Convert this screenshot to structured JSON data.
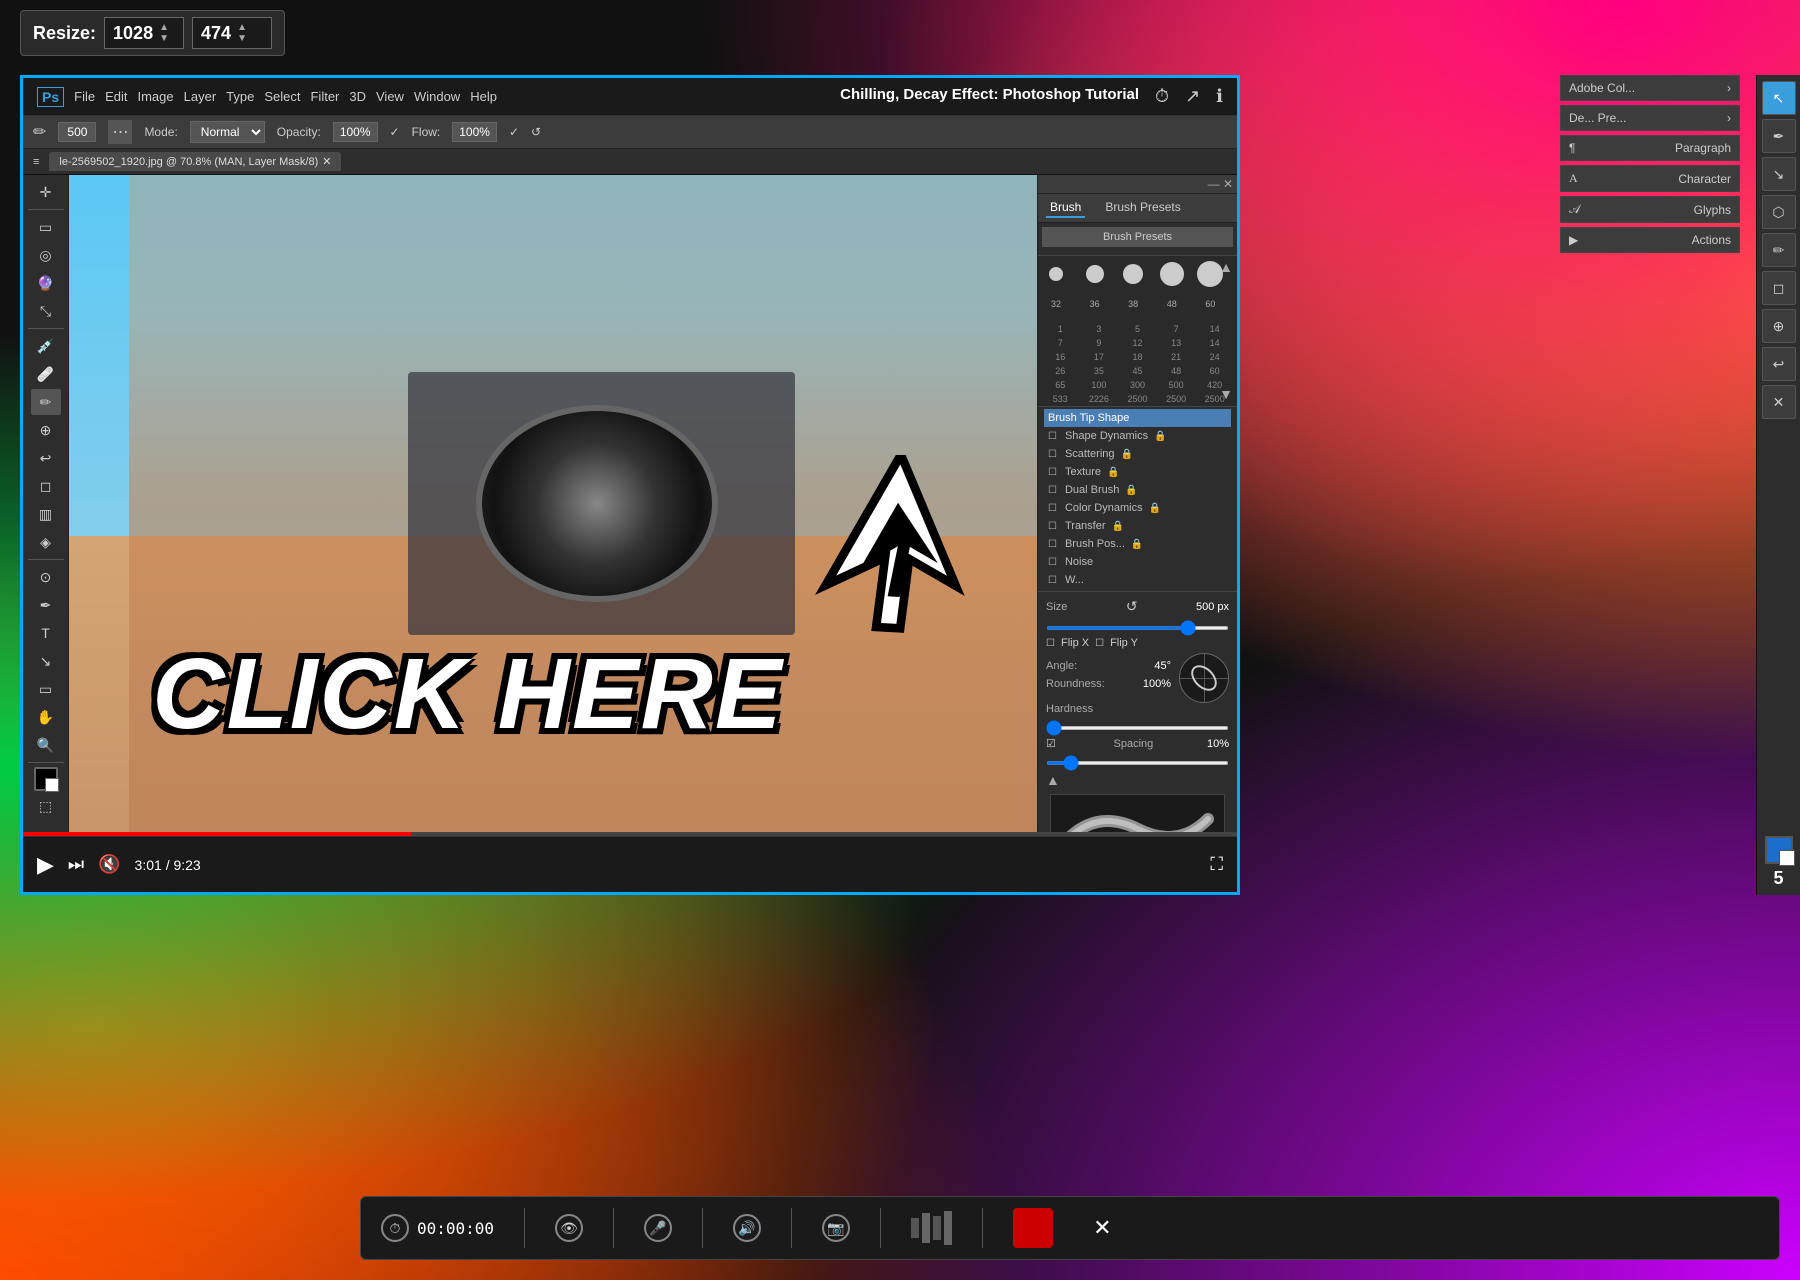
{
  "background": {
    "desc": "colorful swirl background"
  },
  "resize_bar": {
    "label": "Resize:",
    "width": "1028",
    "height": "474"
  },
  "video": {
    "title": "Chilling, Decay Effect: Photoshop Tutorial",
    "current_time": "3:01",
    "total_time": "9:23",
    "progress_pct": 32
  },
  "ps": {
    "logo": "Ps",
    "menu_items": [
      "File",
      "Edit",
      "Image",
      "Layer",
      "Type",
      "Select",
      "Filter",
      "3D",
      "View",
      "Window",
      "Help"
    ],
    "tab_name": "le-2569502_1920.jpg @ 70.8% (MAN, Layer Mask/8)",
    "mode_label": "Mode:",
    "mode_value": "Normal",
    "opacity_label": "Opacity:",
    "opacity_value": "100%",
    "flow_label": "Flow:",
    "flow_value": "100%",
    "brush_size": "500"
  },
  "brush_panel": {
    "tab1": "Brush",
    "tab2": "Brush Presets",
    "presets_btn": "Brush Presets",
    "categories": [
      {
        "name": "Brush Tip Shape",
        "active": true,
        "locked": false
      },
      {
        "name": "Shape Dynamics",
        "active": false,
        "locked": true
      },
      {
        "name": "Scattering",
        "active": false,
        "locked": true
      },
      {
        "name": "Texture",
        "active": false,
        "locked": true
      },
      {
        "name": "Dual Brush",
        "active": false,
        "locked": true
      },
      {
        "name": "Color Dynamics",
        "active": false,
        "locked": true
      },
      {
        "name": "Transfer",
        "active": false,
        "locked": true
      },
      {
        "name": "Brush Pos...",
        "active": false,
        "locked": true
      },
      {
        "name": "Noise",
        "active": false,
        "locked": true
      },
      {
        "name": "W...",
        "active": false,
        "locked": true
      }
    ],
    "brush_sizes": [
      [
        32,
        36,
        38,
        48,
        60
      ],
      [
        1,
        3,
        5,
        7,
        14
      ],
      [
        7,
        9,
        12,
        13,
        14
      ],
      [
        16,
        17,
        18,
        21,
        24
      ],
      [
        26,
        35,
        45,
        48,
        60
      ],
      [
        65,
        100,
        300,
        500,
        420
      ],
      [
        533,
        2226,
        2500,
        2500,
        2500
      ]
    ],
    "size_label": "Size",
    "size_value": "500 px",
    "flip_x": "Flip X",
    "flip_y": "Flip Y",
    "angle_label": "Angle:",
    "angle_value": "45°",
    "roundness_label": "Roundness:",
    "roundness_value": "100%",
    "hardness_label": "Hardness",
    "spacing_label": "Spacing",
    "spacing_value": "10%"
  },
  "tools": {
    "items": [
      "↖",
      "◻",
      "◎",
      "✏",
      "✂",
      "◈",
      "✒",
      "⟳",
      "🖊",
      "T",
      "↙",
      "☁",
      "🔍",
      "⬛",
      "⬜"
    ]
  },
  "right_panels": {
    "panel1": "Adobe Col...",
    "panel2": "De... Pre...",
    "panel3": "Paragraph",
    "panel4": "Character",
    "panel5": "Glyphs",
    "panel6": "Actions"
  },
  "recording_bar": {
    "time": "00:00:00",
    "stop_btn_label": "",
    "close_btn": "✕",
    "camera_icon": "📷",
    "mic_icon": "🎤",
    "speaker_icon": "🔊"
  },
  "click_here": "CLICK HERE",
  "strip_number": "5"
}
